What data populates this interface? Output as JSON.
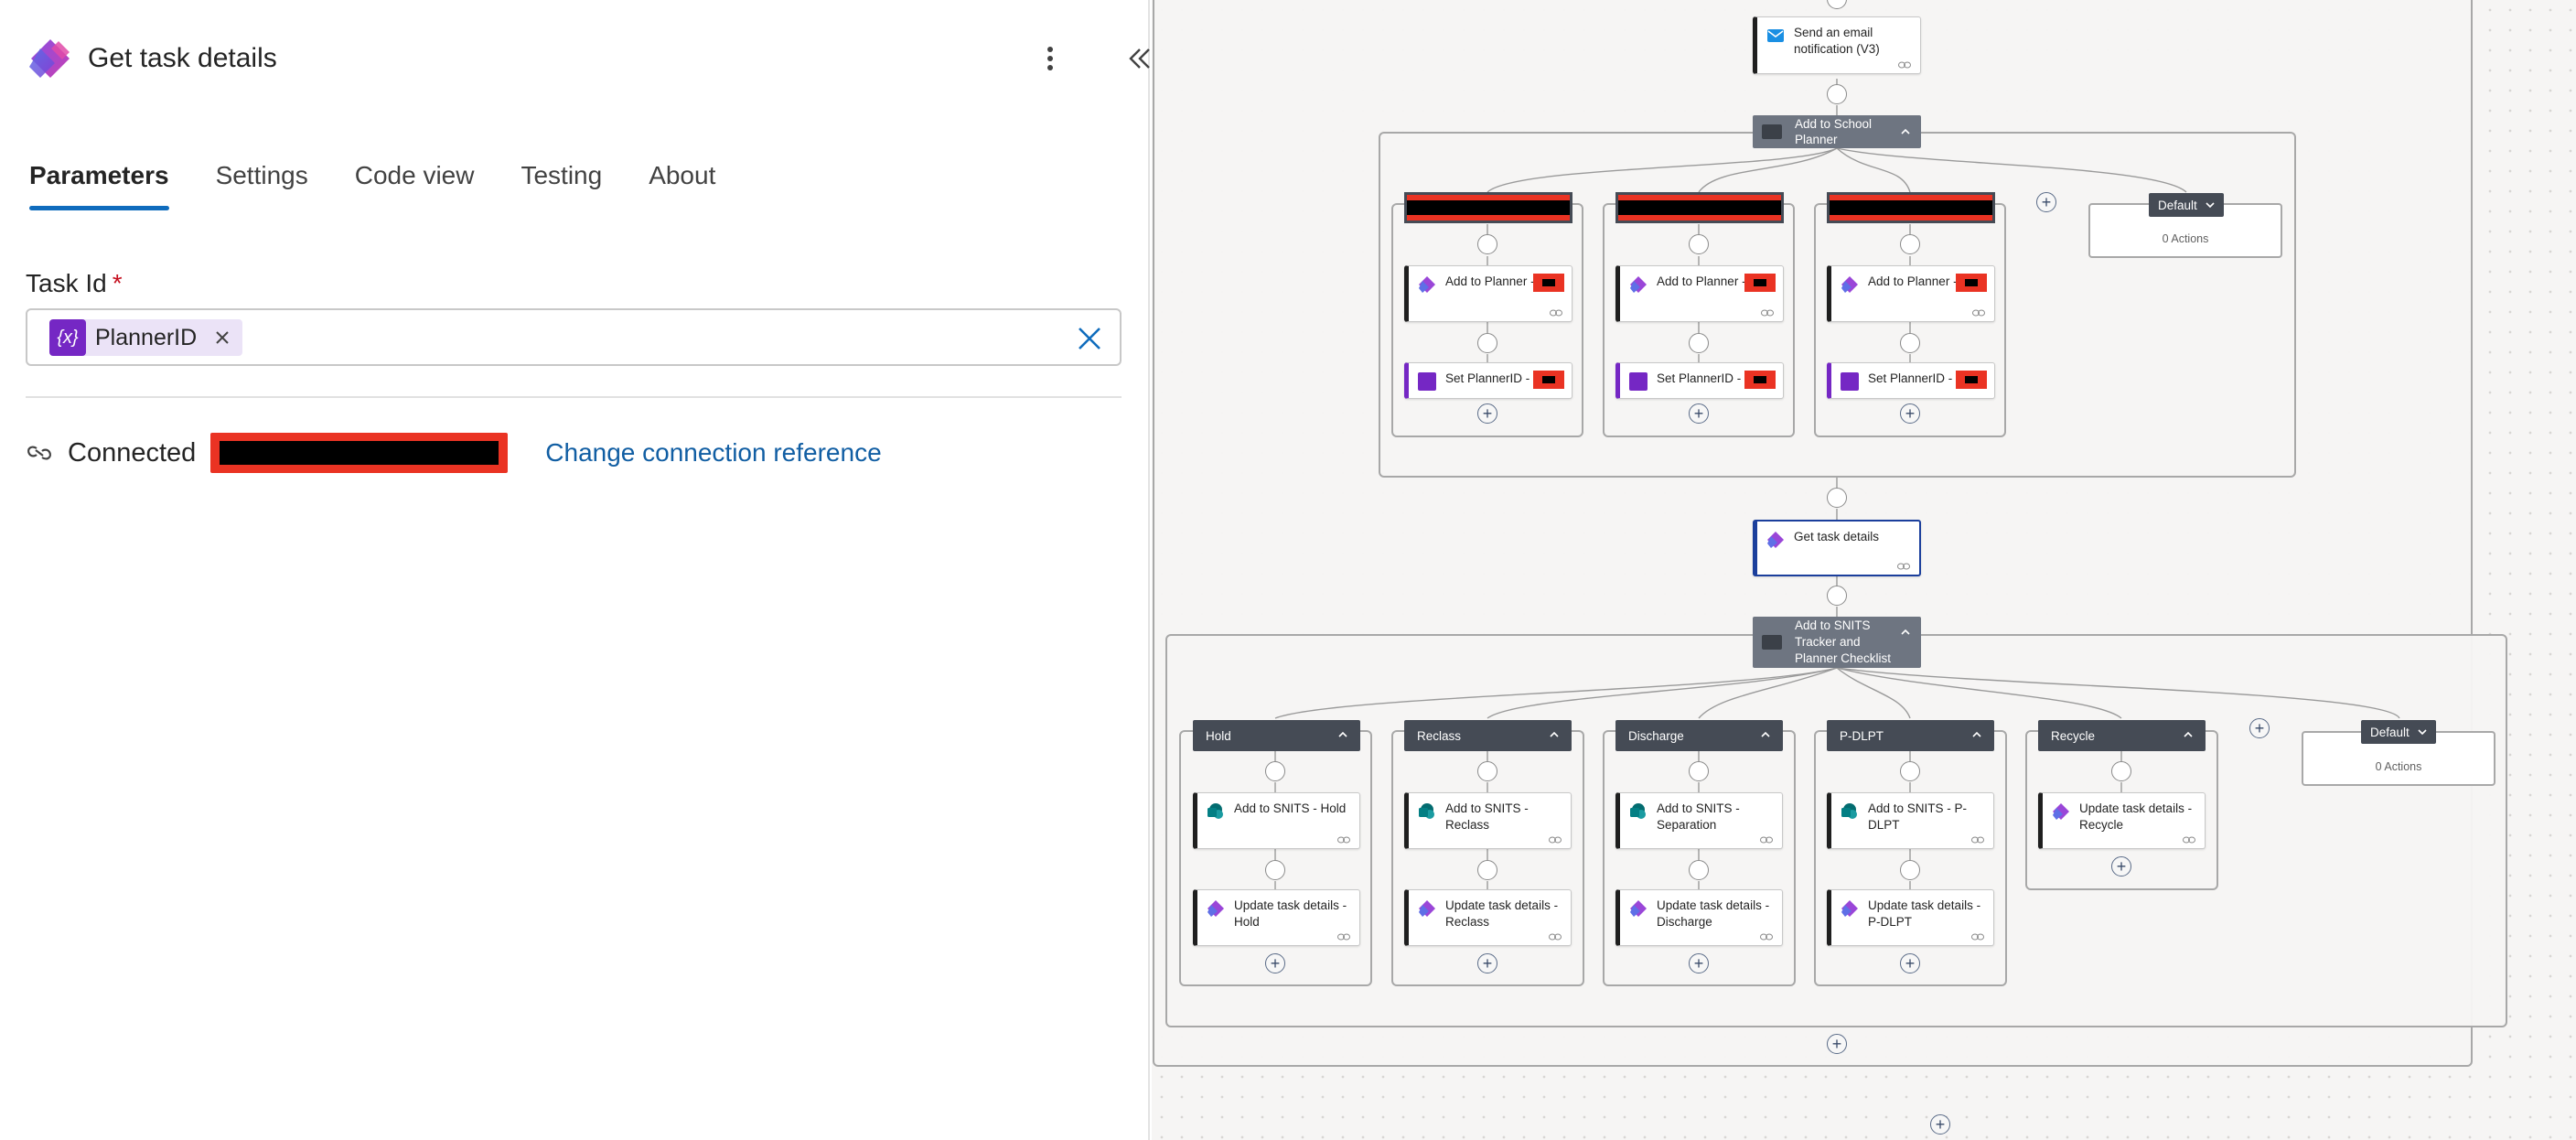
{
  "panel": {
    "title": "Get task details",
    "more_icon": "more-vertical-icon",
    "collapse_icon": "double-chevron-left-icon",
    "tabs": [
      {
        "label": "Parameters",
        "active": true
      },
      {
        "label": "Settings",
        "active": false
      },
      {
        "label": "Code view",
        "active": false
      },
      {
        "label": "Testing",
        "active": false
      },
      {
        "label": "About",
        "active": false
      }
    ],
    "task_id": {
      "label": "Task Id",
      "required_mark": "*",
      "token_icon_text": "{x}",
      "token_label": "PlannerID"
    },
    "connection": {
      "status": "Connected",
      "change_link": "Change connection reference",
      "redaction_color": "#ea3323"
    }
  },
  "flow": {
    "top_card": {
      "label": "Send an email notification (V3)"
    },
    "school_switch": {
      "label_line1": "Add to School",
      "label_line2": "Planner",
      "cases": [
        {
          "action1": "Add to Planner -",
          "action2": "Set PlannerID -"
        },
        {
          "action1": "Add to Planner -",
          "action2": "Set PlannerID -"
        },
        {
          "action1": "Add to Planner -",
          "action2": "Set PlannerID -"
        }
      ],
      "default": {
        "label": "Default",
        "actions": "0 Actions"
      }
    },
    "get_task": {
      "label": "Get task details"
    },
    "snits_switch": {
      "label_line1": "Add to SNITS",
      "label_line2": "Tracker and",
      "label_line3": "Planner Checklist",
      "cases": [
        {
          "name": "Hold",
          "action1_l1": "Add to SNITS - Hold",
          "action1_l2": "",
          "action2_l1": "Update task details -",
          "action2_l2": "Hold"
        },
        {
          "name": "Reclass",
          "action1_l1": "Add to SNITS -",
          "action1_l2": "Reclass",
          "action2_l1": "Update task details -",
          "action2_l2": "Reclass"
        },
        {
          "name": "Discharge",
          "action1_l1": "Add to SNITS -",
          "action1_l2": "Separation",
          "action2_l1": "Update task details -",
          "action2_l2": "Discharge"
        },
        {
          "name": "P-DLPT",
          "action1_l1": "Add to SNITS - P-",
          "action1_l2": "DLPT",
          "action2_l1": "Update task details -",
          "action2_l2": "P-DLPT"
        },
        {
          "name": "Recycle",
          "action1_l1": "Update task details -",
          "action1_l2": "Recycle"
        }
      ],
      "default": {
        "label": "Default",
        "actions": "0 Actions"
      }
    },
    "plus_symbol": "+"
  }
}
